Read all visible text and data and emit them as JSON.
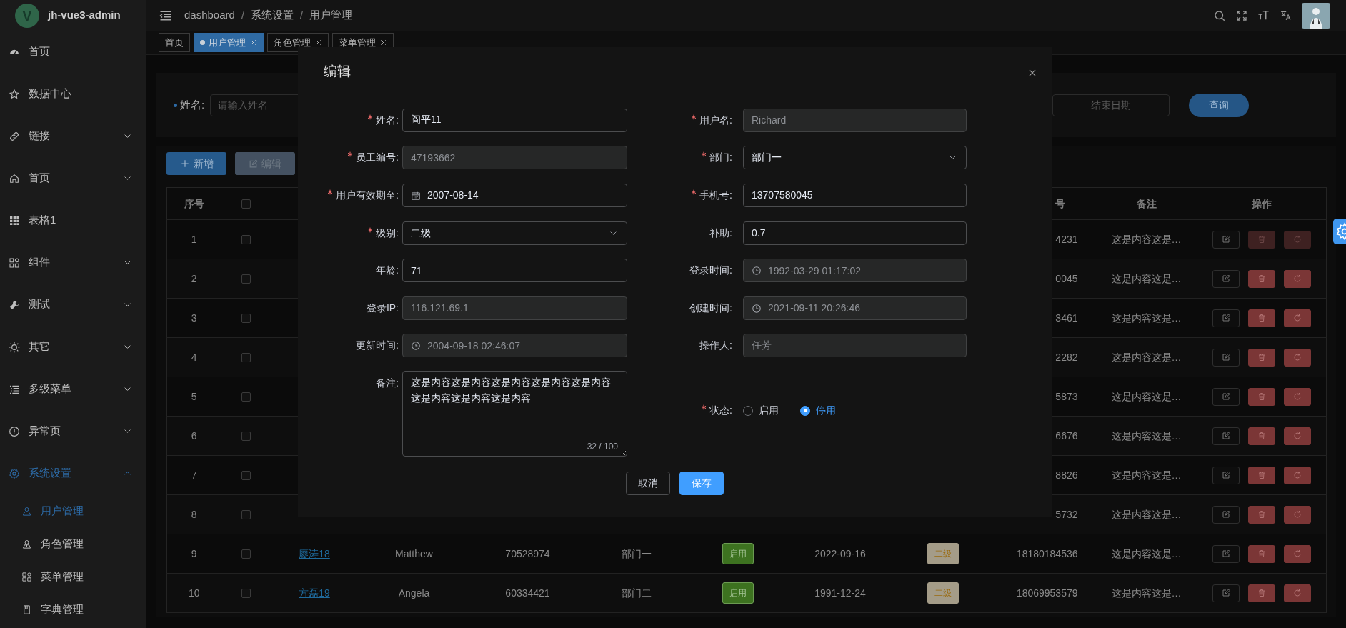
{
  "app": {
    "logo_letter": "V",
    "name": "jh-vue3-admin"
  },
  "breadcrumb": {
    "separator": "/",
    "items": [
      "dashboard",
      "系统设置",
      "用户管理"
    ]
  },
  "tabs": [
    {
      "label": "首页",
      "selected": false,
      "closable": false
    },
    {
      "label": "用户管理",
      "selected": true,
      "closable": true
    },
    {
      "label": "角色管理",
      "selected": false,
      "closable": true
    },
    {
      "label": "菜单管理",
      "selected": false,
      "closable": true
    }
  ],
  "sidebar": {
    "items": [
      {
        "label": "首页",
        "selected": false
      },
      {
        "label": "数据中心",
        "selected": false
      },
      {
        "label": "链接",
        "selected": false,
        "expanded": false
      },
      {
        "label": "首页",
        "selected": false,
        "expanded": false
      },
      {
        "label": "表格1",
        "selected": false
      },
      {
        "label": "组件",
        "selected": false,
        "expanded": false
      },
      {
        "label": "测试",
        "selected": false,
        "expanded": false
      },
      {
        "label": "其它",
        "selected": false,
        "expanded": false
      },
      {
        "label": "多级菜单",
        "selected": false,
        "expanded": false
      },
      {
        "label": "异常页",
        "selected": false,
        "expanded": false
      },
      {
        "label": "系统设置",
        "selected": true,
        "expanded": true,
        "children": [
          {
            "label": "用户管理",
            "selected": true
          },
          {
            "label": "角色管理",
            "selected": false
          },
          {
            "label": "菜单管理",
            "selected": false
          },
          {
            "label": "字典管理",
            "selected": false
          }
        ]
      }
    ]
  },
  "search": {
    "label": "姓名:",
    "placeholder": "请输入姓名",
    "end_date_placeholder": "结束日期",
    "button": "查询"
  },
  "toolbar": [
    {
      "label": "新增",
      "kind": "add",
      "disabled": false
    },
    {
      "label": "编辑",
      "kind": "edit",
      "disabled": true
    }
  ],
  "table": {
    "header_checkbox": {
      "checked": false
    },
    "columns": [
      {
        "kind": "index",
        "label": "序号"
      },
      {
        "kind": "phone",
        "label": "号"
      },
      {
        "kind": "remark",
        "label": "备注"
      },
      {
        "kind": "actions",
        "label": "操作"
      }
    ],
    "rows": [
      {
        "index": "1",
        "checked": false,
        "phone": "4231",
        "remark": "这是内容这是…",
        "actions_disabled": true
      },
      {
        "index": "2",
        "checked": false,
        "phone": "0045",
        "remark": "这是内容这是…",
        "actions_disabled": false
      },
      {
        "index": "3",
        "checked": false,
        "phone": "3461",
        "remark": "这是内容这是…",
        "actions_disabled": false
      },
      {
        "index": "4",
        "checked": false,
        "phone": "2282",
        "remark": "这是内容这是…",
        "actions_disabled": false
      },
      {
        "index": "5",
        "checked": false,
        "phone": "5873",
        "remark": "这是内容这是…",
        "actions_disabled": false
      },
      {
        "index": "6",
        "checked": false,
        "phone": "6676",
        "remark": "这是内容这是…",
        "actions_disabled": false
      },
      {
        "index": "7",
        "checked": false,
        "phone": "8826",
        "remark": "这是内容这是…",
        "actions_disabled": false
      },
      {
        "index": "8",
        "checked": false,
        "phone": "5732",
        "remark": "这是内容这是…",
        "actions_disabled": false
      },
      {
        "index": "9",
        "checked": false,
        "name": "廖涛18",
        "username": "Matthew",
        "employee_no": "70528974",
        "department": "部门一",
        "status": "启用",
        "date": "2022-09-16",
        "level": "二级",
        "phone": "18180184536",
        "remark": "这是内容这是…",
        "actions_disabled": false
      },
      {
        "index": "10",
        "checked": false,
        "name": "方磊19",
        "username": "Angela",
        "employee_no": "60334421",
        "department": "部门二",
        "status": "启用",
        "date": "1991-12-24",
        "level": "二级",
        "phone": "18069953579",
        "remark": "这是内容这是…",
        "actions_disabled": false
      }
    ]
  },
  "modal": {
    "title": "编辑",
    "fields": [
      {
        "label": "姓名:",
        "required": true,
        "kind": "text",
        "value": "阎平11",
        "disabled": false
      },
      {
        "label": "用户名:",
        "required": true,
        "kind": "text",
        "value": "Richard",
        "disabled": true
      },
      {
        "label": "员工编号:",
        "required": true,
        "kind": "text",
        "value": "47193662",
        "disabled": true
      },
      {
        "label": "部门:",
        "required": true,
        "kind": "select",
        "value": "部门一",
        "disabled": false
      },
      {
        "label": "用户有效期至:",
        "required": true,
        "kind": "date",
        "value": "2007-08-14",
        "disabled": false
      },
      {
        "label": "手机号:",
        "required": true,
        "kind": "text",
        "value": "13707580045",
        "disabled": false
      },
      {
        "label": "级别:",
        "required": true,
        "kind": "select",
        "value": "二级",
        "disabled": false
      },
      {
        "label": "补助:",
        "required": false,
        "kind": "text",
        "value": "0.7",
        "disabled": false
      },
      {
        "label": "年龄:",
        "required": false,
        "kind": "text",
        "value": "71",
        "disabled": false
      },
      {
        "label": "登录时间:",
        "required": false,
        "kind": "datetime",
        "value": "1992-03-29 01:17:02",
        "disabled": true
      },
      {
        "label": "登录IP:",
        "required": false,
        "kind": "text",
        "value": "116.121.69.1",
        "disabled": true
      },
      {
        "label": "创建时间:",
        "required": false,
        "kind": "datetime",
        "value": "2021-09-11 20:26:46",
        "disabled": true
      },
      {
        "label": "更新时间:",
        "required": false,
        "kind": "datetime",
        "value": "2004-09-18 02:46:07",
        "disabled": true
      },
      {
        "label": "操作人:",
        "required": false,
        "kind": "text",
        "value": "任芳",
        "disabled": true
      },
      {
        "label": "备注:",
        "required": false,
        "kind": "textarea",
        "value": "这是内容这是内容这是内容这是内容这是内容这是内容这是内容这是内容",
        "counter": "32 / 100",
        "disabled": false
      },
      {
        "label": "状态:",
        "required": true,
        "kind": "radio",
        "options": [
          {
            "label": "启用",
            "selected": false
          },
          {
            "label": "停用",
            "selected": true
          }
        ]
      }
    ],
    "buttons": [
      {
        "label": "取消",
        "kind": "default"
      },
      {
        "label": "保存",
        "kind": "primary"
      }
    ]
  }
}
